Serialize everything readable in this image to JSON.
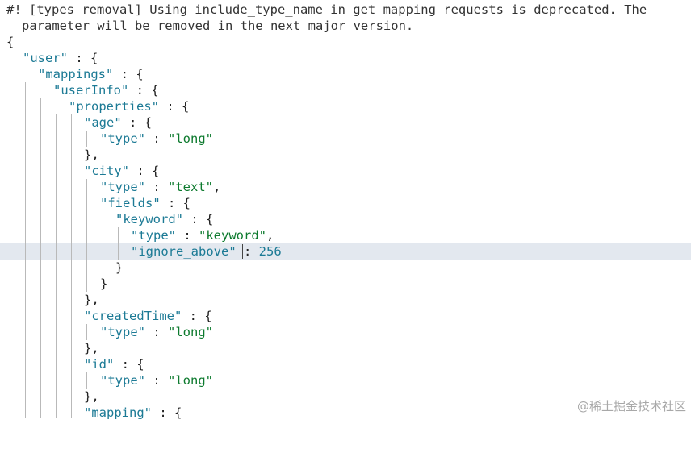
{
  "comment": {
    "line1": "#! [types removal] Using include_type_name in get mapping requests is deprecated. The",
    "line2": "parameter will be removed in the next major version."
  },
  "code_lines": [
    {
      "k": "",
      "s": "",
      "n": "",
      "after": "{"
    },
    {
      "k": "\"user\"",
      "s": "",
      "n": "",
      "after": " : {"
    },
    {
      "k": "\"mappings\"",
      "s": "",
      "n": "",
      "after": " : {"
    },
    {
      "k": "\"userInfo\"",
      "s": "",
      "n": "",
      "after": " : {"
    },
    {
      "k": "\"properties\"",
      "s": "",
      "n": "",
      "after": " : {"
    },
    {
      "k": "\"age\"",
      "s": "",
      "n": "",
      "after": " : {"
    },
    {
      "k": "\"type\"",
      "s": "\"long\"",
      "n": "",
      "after": ""
    },
    {
      "k": "",
      "s": "",
      "n": "",
      "after": "},"
    },
    {
      "k": "\"city\"",
      "s": "",
      "n": "",
      "after": " : {"
    },
    {
      "k": "\"type\"",
      "s": "\"text\"",
      "n": "",
      "after": ","
    },
    {
      "k": "\"fields\"",
      "s": "",
      "n": "",
      "after": " : {"
    },
    {
      "k": "\"keyword\"",
      "s": "",
      "n": "",
      "after": " : {"
    },
    {
      "k": "\"type\"",
      "s": "\"keyword\"",
      "n": "",
      "after": ","
    },
    {
      "k": "\"ignore_above\"",
      "s": "",
      "n": "256",
      "after": ""
    },
    {
      "k": "",
      "s": "",
      "n": "",
      "after": "}"
    },
    {
      "k": "",
      "s": "",
      "n": "",
      "after": "}"
    },
    {
      "k": "",
      "s": "",
      "n": "",
      "after": "},"
    },
    {
      "k": "\"createdTime\"",
      "s": "",
      "n": "",
      "after": " : {"
    },
    {
      "k": "\"type\"",
      "s": "\"long\"",
      "n": "",
      "after": ""
    },
    {
      "k": "",
      "s": "",
      "n": "",
      "after": "},"
    },
    {
      "k": "\"id\"",
      "s": "",
      "n": "",
      "after": " : {"
    },
    {
      "k": "\"type\"",
      "s": "\"long\"",
      "n": "",
      "after": ""
    },
    {
      "k": "",
      "s": "",
      "n": "",
      "after": "},"
    },
    {
      "k": "\"mapping\"",
      "s": "",
      "n": "",
      "after": " : {"
    }
  ],
  "watermark": "@稀土掘金技术社区",
  "colors": {
    "key": "#1c7a95",
    "string": "#0d7a2e",
    "number": "#1c7a95",
    "active_line": "#e3e8ef",
    "indent_guide": "#b9b9b9"
  }
}
